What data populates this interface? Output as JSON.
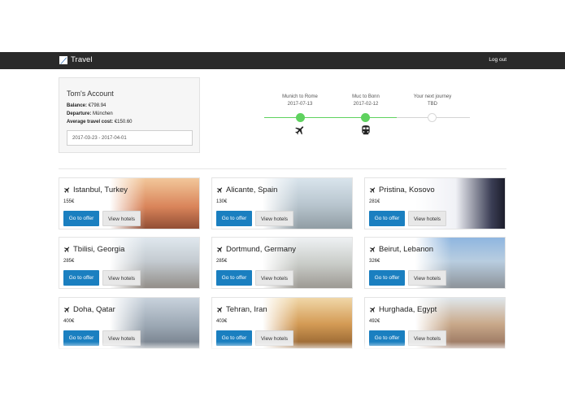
{
  "brand": {
    "name": "Travel",
    "logo_icon": "pen-logo-icon"
  },
  "nav": {
    "logout": "Log out"
  },
  "account": {
    "title": "Tom's Account",
    "balance_label": "Balance:",
    "balance_value": "€798.94",
    "departure_label": "Departure:",
    "departure_value": "München",
    "avg_cost_label": "Average travel cost:",
    "avg_cost_value": "€150.60",
    "date_range": "2017-03-23 - 2017-04-01"
  },
  "timeline": {
    "stops": [
      {
        "label": "Munich to Rome",
        "date": "2017-07-13",
        "status": "done",
        "icon": "plane-icon"
      },
      {
        "label": "Muc to Bonn",
        "date": "2017-02-12",
        "status": "done",
        "icon": "train-icon"
      },
      {
        "label": "Your next journey",
        "date": "TBD",
        "status": "todo",
        "icon": ""
      }
    ]
  },
  "offers": {
    "go_label": "Go to offer",
    "hotels_label": "View hotels",
    "items": [
      {
        "destination": "Istanbul, Turkey",
        "price": "155€"
      },
      {
        "destination": "Alicante, Spain",
        "price": "130€"
      },
      {
        "destination": "Pristina, Kosovo",
        "price": "281€"
      },
      {
        "destination": "Tbilisi, Georgia",
        "price": "285€"
      },
      {
        "destination": "Dortmund, Germany",
        "price": "285€"
      },
      {
        "destination": "Beirut, Lebanon",
        "price": "326€"
      },
      {
        "destination": "Doha, Qatar",
        "price": "400€"
      },
      {
        "destination": "Tehran, Iran",
        "price": "403€"
      },
      {
        "destination": "Hurghada, Egypt",
        "price": "492€"
      }
    ]
  },
  "colors": {
    "navbar": "#2a2a2a",
    "primary_button": "#1a7fc0",
    "timeline_green": "#5fd25f"
  }
}
